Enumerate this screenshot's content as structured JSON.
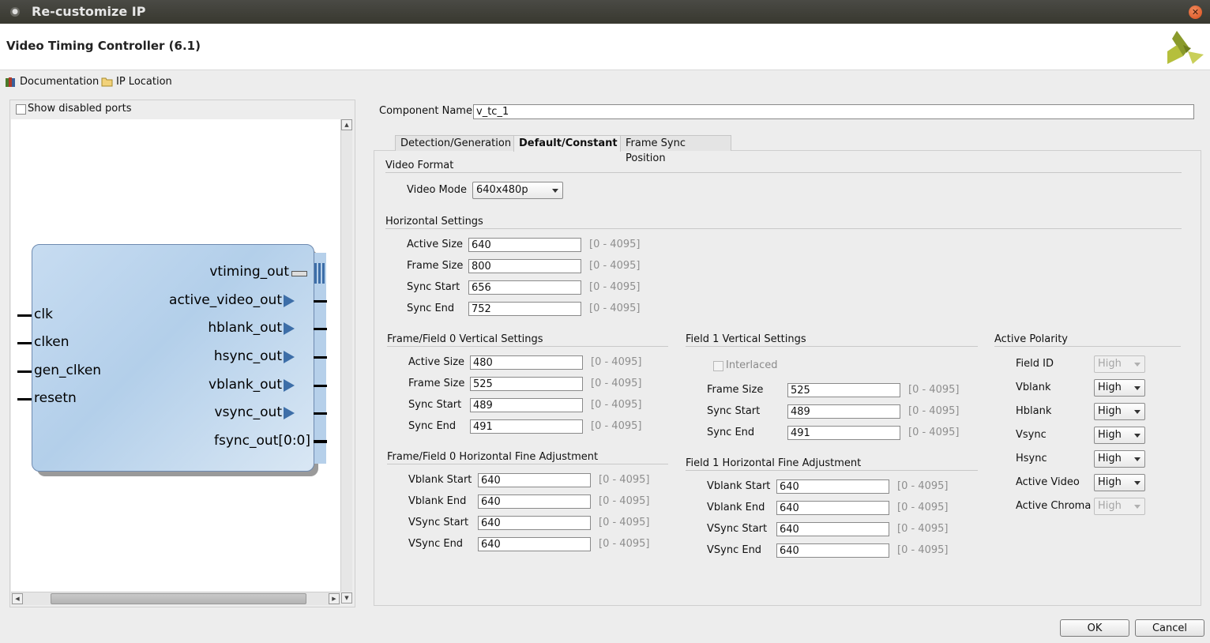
{
  "window": {
    "title": "Re-customize IP"
  },
  "header": {
    "title": "Video Timing Controller (6.1)"
  },
  "toolbar": {
    "documentation": "Documentation",
    "ip_location": "IP Location"
  },
  "left": {
    "show_disabled_ports": "Show disabled ports",
    "block": {
      "inputs": [
        "clk",
        "clken",
        "gen_clken",
        "resetn"
      ],
      "outputs": [
        "vtiming_out",
        "active_video_out",
        "hblank_out",
        "hsync_out",
        "vblank_out",
        "vsync_out",
        "fsync_out[0:0]"
      ]
    }
  },
  "component": {
    "label": "Component Name",
    "value": "v_tc_1"
  },
  "tabs": [
    "Detection/Generation",
    "Default/Constant",
    "Frame Sync Position"
  ],
  "video_format": {
    "title": "Video Format",
    "mode_label": "Video Mode",
    "mode_value": "640x480p"
  },
  "horizontal": {
    "title": "Horizontal Settings",
    "rows": [
      {
        "label": "Active Size",
        "value": "640",
        "range": "[0 - 4095]"
      },
      {
        "label": "Frame Size",
        "value": "800",
        "range": "[0 - 4095]"
      },
      {
        "label": "Sync Start",
        "value": "656",
        "range": "[0 - 4095]"
      },
      {
        "label": "Sync End",
        "value": "752",
        "range": "[0 - 4095]"
      }
    ]
  },
  "f0_vertical": {
    "title": "Frame/Field 0 Vertical Settings",
    "rows": [
      {
        "label": "Active Size",
        "value": "480",
        "range": "[0 - 4095]"
      },
      {
        "label": "Frame Size",
        "value": "525",
        "range": "[0 - 4095]"
      },
      {
        "label": "Sync Start",
        "value": "489",
        "range": "[0 - 4095]"
      },
      {
        "label": "Sync End",
        "value": "491",
        "range": "[0 - 4095]"
      }
    ]
  },
  "f1_vertical": {
    "title": "Field 1 Vertical Settings",
    "interlaced": "Interlaced",
    "rows": [
      {
        "label": "Frame Size",
        "value": "525",
        "range": "[0 - 4095]"
      },
      {
        "label": "Sync Start",
        "value": "489",
        "range": "[0 - 4095]"
      },
      {
        "label": "Sync End",
        "value": "491",
        "range": "[0 - 4095]"
      }
    ]
  },
  "f0_fine": {
    "title": "Frame/Field 0 Horizontal Fine Adjustment",
    "rows": [
      {
        "label": "Vblank Start",
        "value": "640",
        "range": "[0 - 4095]"
      },
      {
        "label": "Vblank End",
        "value": "640",
        "range": "[0 - 4095]"
      },
      {
        "label": "VSync Start",
        "value": "640",
        "range": "[0 - 4095]"
      },
      {
        "label": "VSync End",
        "value": "640",
        "range": "[0 - 4095]"
      }
    ]
  },
  "f1_fine": {
    "title": "Field 1 Horizontal Fine Adjustment",
    "rows": [
      {
        "label": "Vblank Start",
        "value": "640",
        "range": "[0 - 4095]"
      },
      {
        "label": "Vblank End",
        "value": "640",
        "range": "[0 - 4095]"
      },
      {
        "label": "VSync Start",
        "value": "640",
        "range": "[0 - 4095]"
      },
      {
        "label": "VSync End",
        "value": "640",
        "range": "[0 - 4095]"
      }
    ]
  },
  "polarity": {
    "title": "Active Polarity",
    "rows": [
      {
        "label": "Field ID",
        "value": "High",
        "enabled": false
      },
      {
        "label": "Vblank",
        "value": "High",
        "enabled": true
      },
      {
        "label": "Hblank",
        "value": "High",
        "enabled": true
      },
      {
        "label": "Vsync",
        "value": "High",
        "enabled": true
      },
      {
        "label": "Hsync",
        "value": "High",
        "enabled": true
      },
      {
        "label": "Active Video",
        "value": "High",
        "enabled": true
      },
      {
        "label": "Active Chroma",
        "value": "High",
        "enabled": false
      }
    ]
  },
  "buttons": {
    "ok": "OK",
    "cancel": "Cancel"
  }
}
